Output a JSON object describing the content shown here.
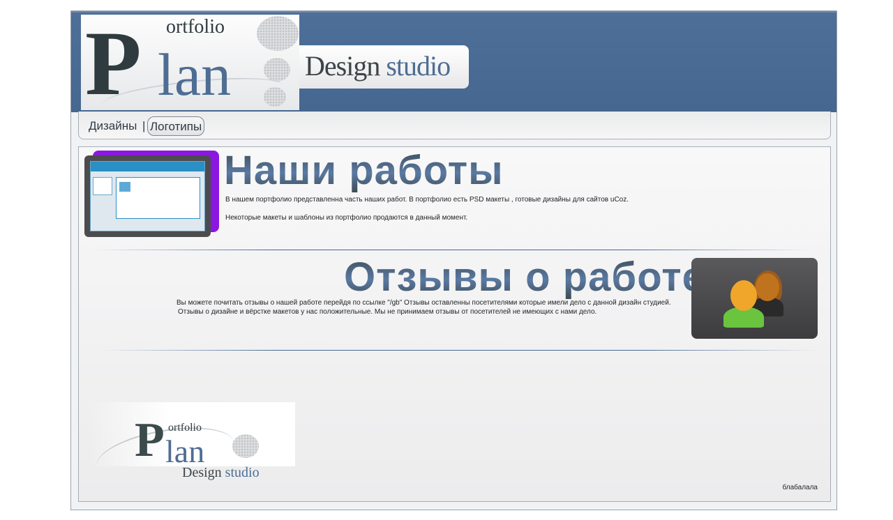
{
  "header": {
    "logo": {
      "letter": "P",
      "ortfolio": "ortfolio",
      "lan": "lan"
    },
    "tagline": {
      "word1": "Design",
      "word2": "studio"
    }
  },
  "nav": {
    "items": [
      {
        "label": "Дизайны"
      },
      {
        "label": "Логотипы",
        "active": true
      }
    ],
    "separator": "|"
  },
  "sections": {
    "works": {
      "title": "Наши работы",
      "p1": "В нашем портфолио представленна часть наших работ. В портфолио есть PSD макеты , готовые дизайны для сайтов uCoz.",
      "p2": "Некоторые макеты и шаблоны из портфолио продаются в данный момент."
    },
    "reviews": {
      "title": "Отзывы о работе",
      "p1": "Вы можете почитать отзывы о нашей работе перейдя по ссылке \"/gb\"  Отзывы оставленны посетителями которые имели дело с данной дизайн студией.",
      "p2": "Отзывы о дизайне и вёрстке макетов у нас положительные.  Мы не принимаем отзывы от посетителей не имеющих с нами дело.",
      "icon": "users-icon"
    }
  },
  "footer": {
    "logo": {
      "letter": "P",
      "ortfolio": "ortfolio",
      "lan": "lan",
      "word1": "Design",
      "word2": "studio"
    },
    "text": "блабалала"
  },
  "colors": {
    "header_bg": "#456790",
    "accent": "#4e6d93",
    "thumb_accent": "#8a18e0"
  }
}
